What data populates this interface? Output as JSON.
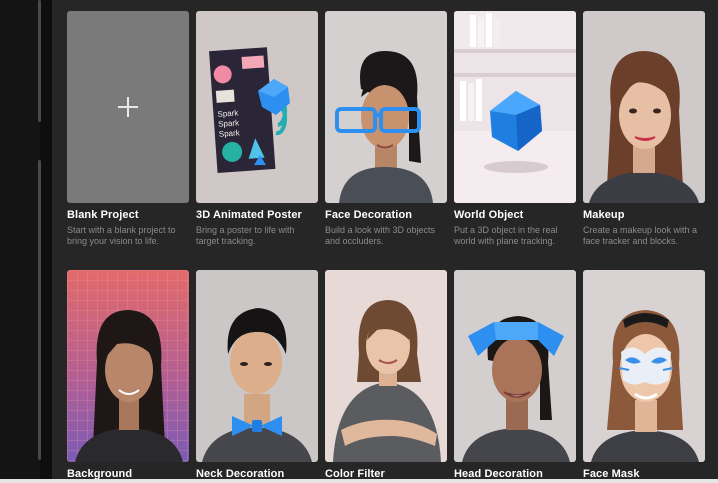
{
  "templates": [
    {
      "title": "Blank Project",
      "description": "Start with a blank project to bring your vision to life."
    },
    {
      "title": "3D Animated Poster",
      "description": "Bring a poster to life with target tracking."
    },
    {
      "title": "Face Decoration",
      "description": "Build a look with 3D objects and occluders."
    },
    {
      "title": "World Object",
      "description": "Put a 3D object in the real world with plane tracking."
    },
    {
      "title": "Makeup",
      "description": "Create a makeup look with a face tracker and blocks."
    },
    {
      "title": "Background",
      "description": ""
    },
    {
      "title": "Neck Decoration",
      "description": ""
    },
    {
      "title": "Color Filter",
      "description": ""
    },
    {
      "title": "Head Decoration",
      "description": ""
    },
    {
      "title": "Face Mask",
      "description": ""
    }
  ],
  "poster_text": [
    "Spark",
    "Spark",
    "Spark"
  ],
  "colors": {
    "panel_bg": "#262626",
    "accent_blue": "#2d8ff0",
    "title_text": "#ffffff",
    "desc_text": "#8b8b8b"
  }
}
